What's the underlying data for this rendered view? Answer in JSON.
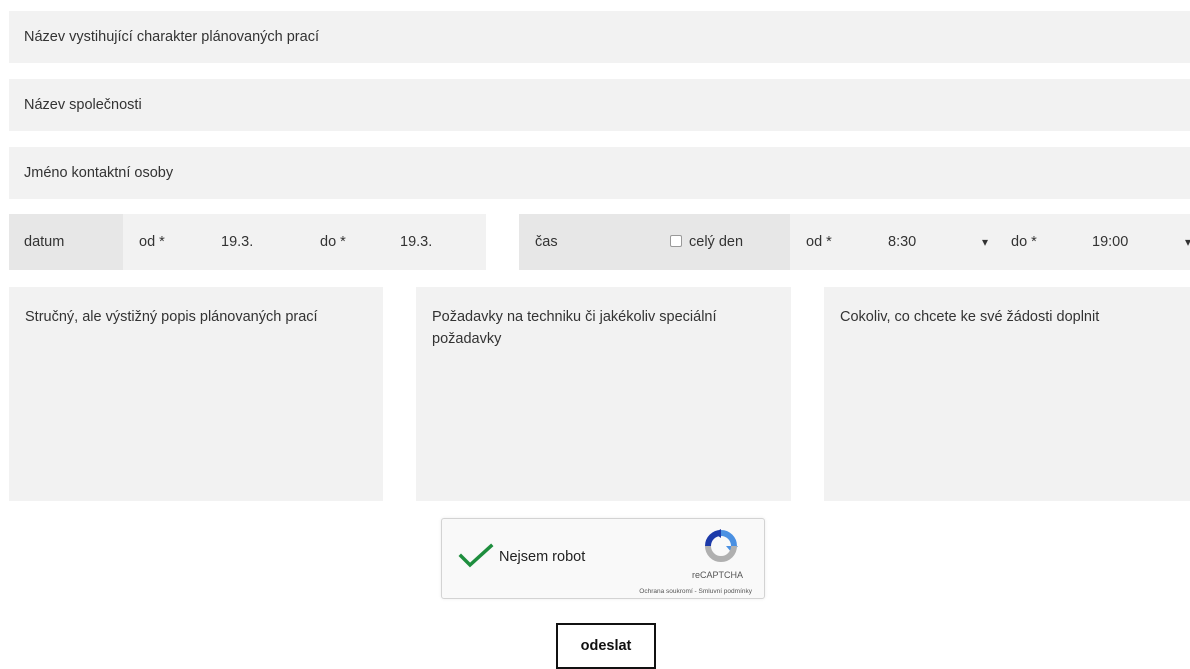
{
  "form": {
    "title_placeholder": "Název vystihující charakter plánovaných prací",
    "company_placeholder": "Název společnosti",
    "contact_placeholder": "Jméno kontaktní osoby",
    "date": {
      "label": "datum",
      "from_label": "od *",
      "from_value": "19.3.",
      "to_label": "do *",
      "to_value": "19.3."
    },
    "time": {
      "label": "čas",
      "all_day_label": "celý den",
      "from_label": "od *",
      "from_value": "8:30",
      "to_label": "do *",
      "to_value": "19:00",
      "caret": "▾"
    },
    "description_placeholder": "Stručný, ale výstižný popis plánovaných prací",
    "requirements_placeholder": "Požadavky na techniku či jakékoliv speciální požadavky",
    "notes_placeholder": "Cokoliv, co chcete ke své žádosti doplnit",
    "submit_label": "odeslat"
  },
  "captcha": {
    "label": "Nejsem robot",
    "brand": "reCAPTCHA",
    "links": "Ochrana soukromí - Smluvní podmínky",
    "check_color": "#1e8e3e",
    "checked": true
  }
}
